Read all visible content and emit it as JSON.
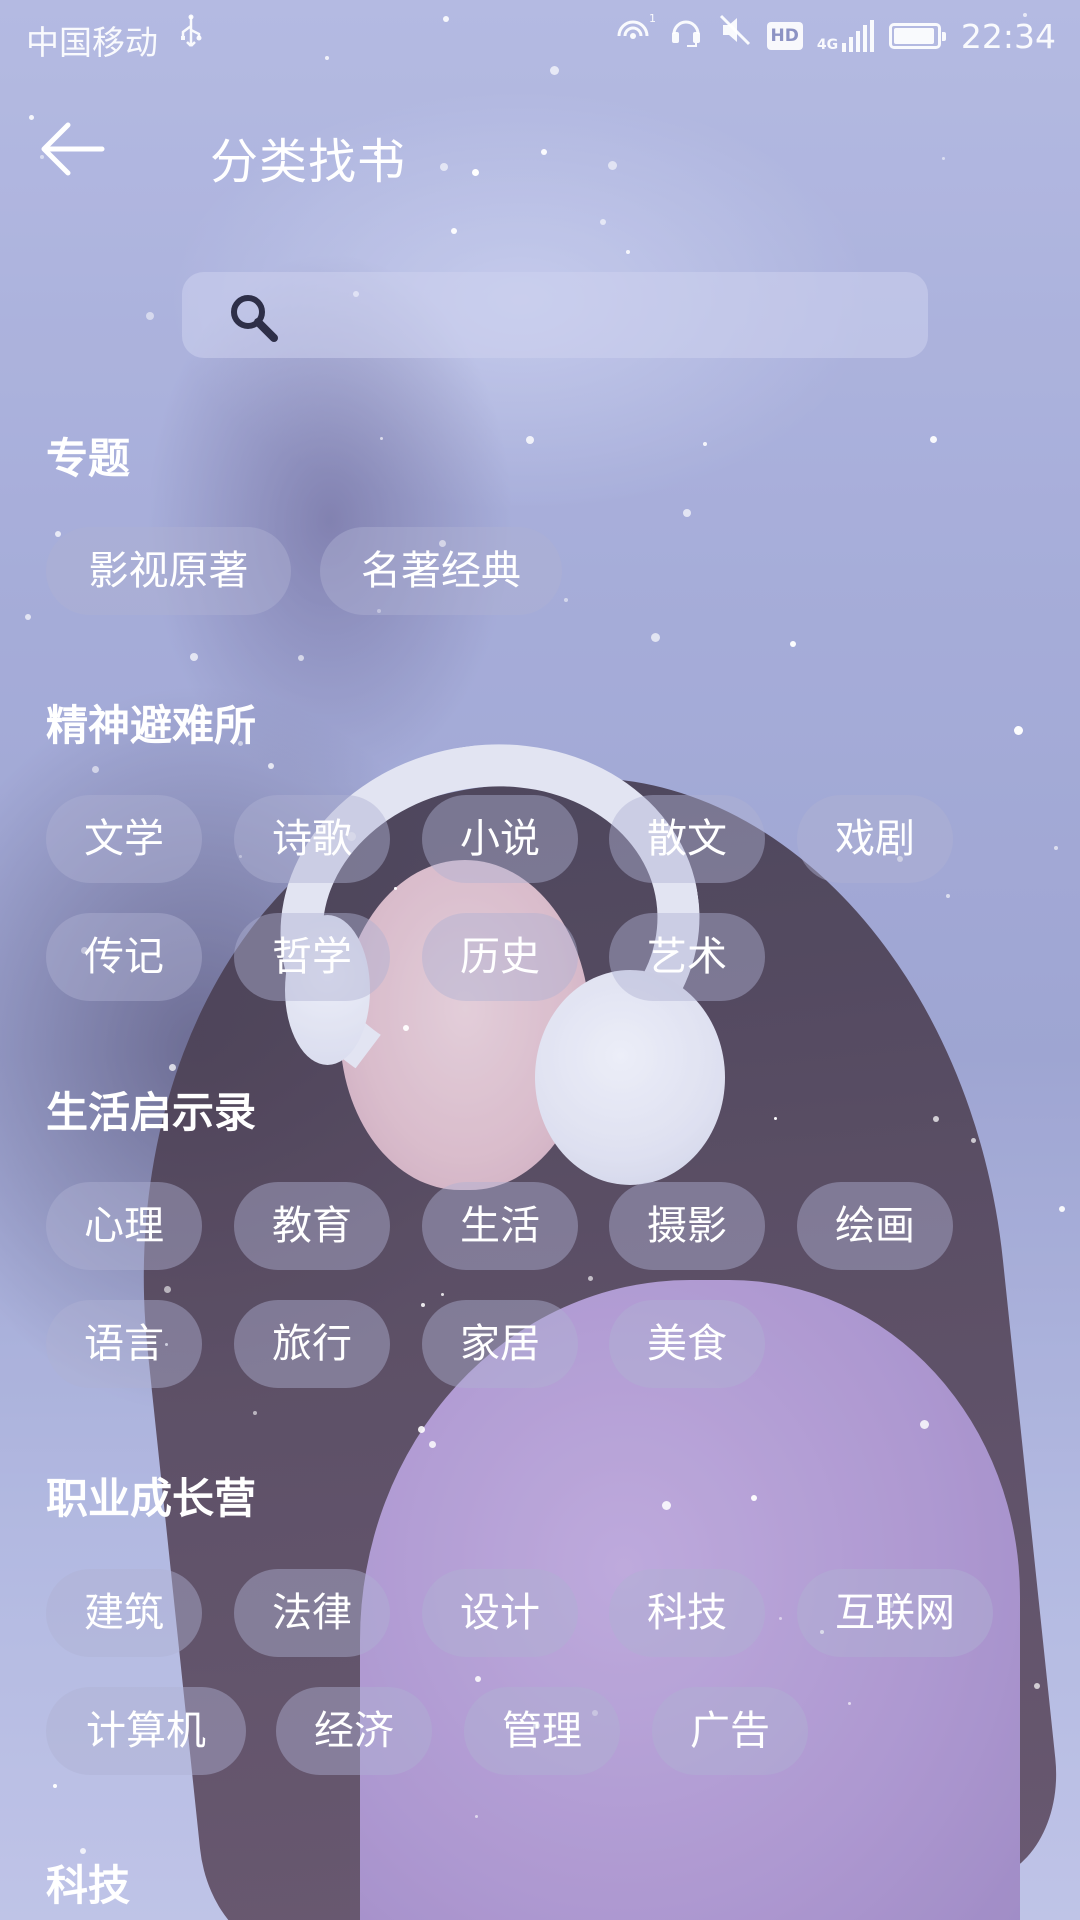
{
  "status_bar": {
    "carrier": "中国移动",
    "usb_icon": "usb-icon",
    "hd_label": "HD",
    "network_label": "4G",
    "battery_level": 0.95,
    "time": "22:34"
  },
  "header": {
    "back_icon": "arrow-left-icon",
    "title": "分类找书"
  },
  "search": {
    "icon": "search-icon",
    "value": "",
    "placeholder": ""
  },
  "sections": [
    {
      "title": "专题",
      "tags": [
        "影视原著",
        "名著经典"
      ]
    },
    {
      "title": "精神避难所",
      "tags": [
        "文学",
        "诗歌",
        "小说",
        "散文",
        "戏剧",
        "传记",
        "哲学",
        "历史",
        "艺术"
      ]
    },
    {
      "title": "生活启示录",
      "tags": [
        "心理",
        "教育",
        "生活",
        "摄影",
        "绘画",
        "语言",
        "旅行",
        "家居",
        "美食"
      ]
    },
    {
      "title": "职业成长营",
      "tags": [
        "建筑",
        "法律",
        "设计",
        "科技",
        "互联网",
        "计算机",
        "经济",
        "管理",
        "广告"
      ]
    },
    {
      "title": "科技",
      "tags": []
    }
  ],
  "colors": {
    "text": "#ffffff",
    "tag_background": "rgba(175,178,210,0.45)",
    "search_background": "rgba(205,210,238,0.55)"
  }
}
